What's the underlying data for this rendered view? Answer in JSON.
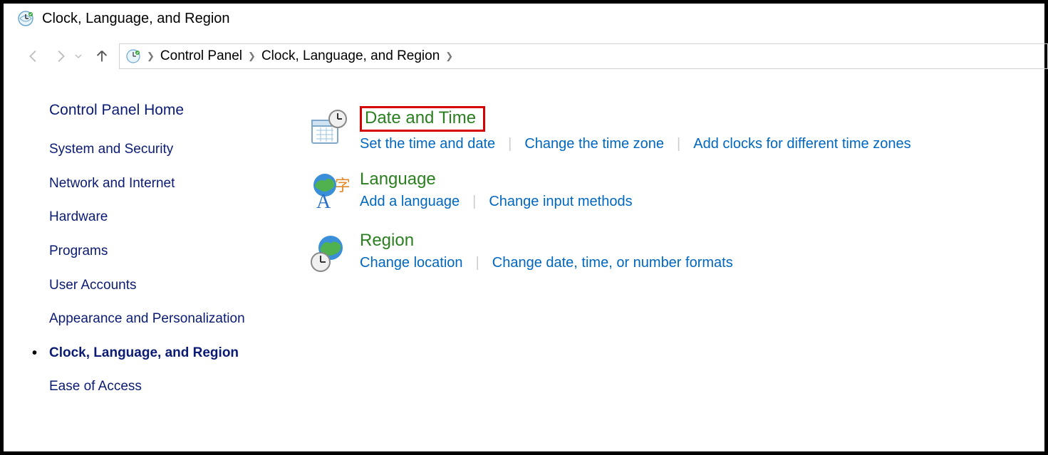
{
  "window": {
    "title": "Clock, Language, and Region"
  },
  "breadcrumb": {
    "items": [
      "Control Panel",
      "Clock, Language, and Region"
    ]
  },
  "sidebar": {
    "home": "Control Panel Home",
    "items": [
      {
        "label": "System and Security",
        "active": false
      },
      {
        "label": "Network and Internet",
        "active": false
      },
      {
        "label": "Hardware",
        "active": false
      },
      {
        "label": "Programs",
        "active": false
      },
      {
        "label": "User Accounts",
        "active": false
      },
      {
        "label": "Appearance and Personalization",
        "active": false
      },
      {
        "label": "Clock, Language, and Region",
        "active": true
      },
      {
        "label": "Ease of Access",
        "active": false
      }
    ]
  },
  "main": {
    "categories": [
      {
        "title": "Date and Time",
        "highlighted": true,
        "icon": "calendar-clock-icon",
        "links": [
          "Set the time and date",
          "Change the time zone",
          "Add clocks for different time zones"
        ]
      },
      {
        "title": "Language",
        "highlighted": false,
        "icon": "language-globe-icon",
        "links": [
          "Add a language",
          "Change input methods"
        ]
      },
      {
        "title": "Region",
        "highlighted": false,
        "icon": "region-globe-clock-icon",
        "links": [
          "Change location",
          "Change date, time, or number formats"
        ]
      }
    ]
  }
}
